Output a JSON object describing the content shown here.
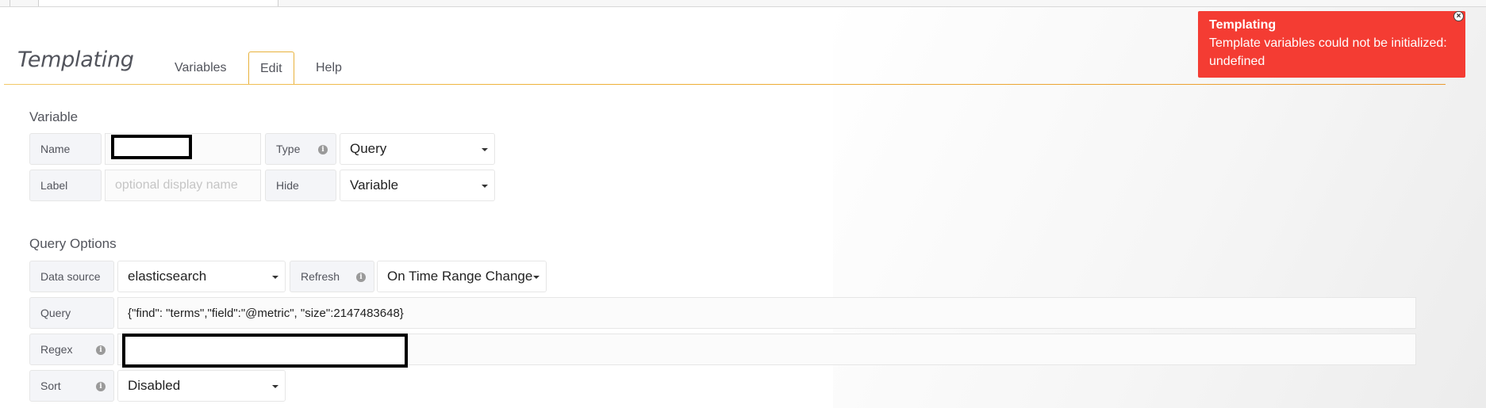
{
  "header": {
    "title": "Templating",
    "tabs": [
      "Variables",
      "Edit",
      "Help"
    ],
    "active_tab": "Edit"
  },
  "variable": {
    "section_title": "Variable",
    "name_label": "Name",
    "name_value": "",
    "type_label": "Type",
    "type_value": "Query",
    "label_label": "Label",
    "label_placeholder": "optional display name",
    "hide_label": "Hide",
    "hide_value": "Variable"
  },
  "query_options": {
    "section_title": "Query Options",
    "datasource_label": "Data source",
    "datasource_value": "elasticsearch",
    "refresh_label": "Refresh",
    "refresh_value": "On Time Range Change",
    "query_label": "Query",
    "query_value": "{\"find\": \"terms\",\"field\":\"@metric\", \"size\":2147483648}",
    "regex_label": "Regex",
    "regex_value": "",
    "sort_label": "Sort",
    "sort_value": "Disabled"
  },
  "alert": {
    "title": "Templating",
    "message": "Template variables could not be initialized: undefined",
    "color": "#f43c33"
  },
  "colors": {
    "accent": "#eb9a2f"
  }
}
